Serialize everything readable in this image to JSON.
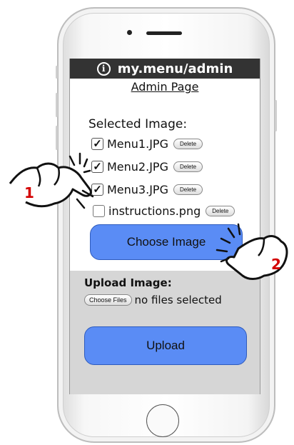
{
  "app": {
    "title": "my.menu/admin",
    "page_link": "Admin Page"
  },
  "selected": {
    "label": "Selected Image:",
    "items": [
      {
        "name": "Menu1.JPG",
        "checked": true,
        "delete_label": "Delete"
      },
      {
        "name": "Menu2.JPG",
        "checked": true,
        "delete_label": "Delete"
      },
      {
        "name": "Menu3.JPG",
        "checked": true,
        "delete_label": "Delete"
      },
      {
        "name": "instructions.png",
        "checked": false,
        "delete_label": "Delete"
      }
    ],
    "choose_label": "Choose Image"
  },
  "upload": {
    "title": "Upload Image:",
    "choose_files_label": "Choose Files",
    "file_status": "no files selected",
    "upload_label": "Upload"
  },
  "annotations": {
    "step1": "1",
    "step2": "2"
  },
  "colors": {
    "accent": "#5a8cf5",
    "titlebar": "#333333",
    "panel": "#d6d6d6",
    "annotation": "#d40000"
  }
}
